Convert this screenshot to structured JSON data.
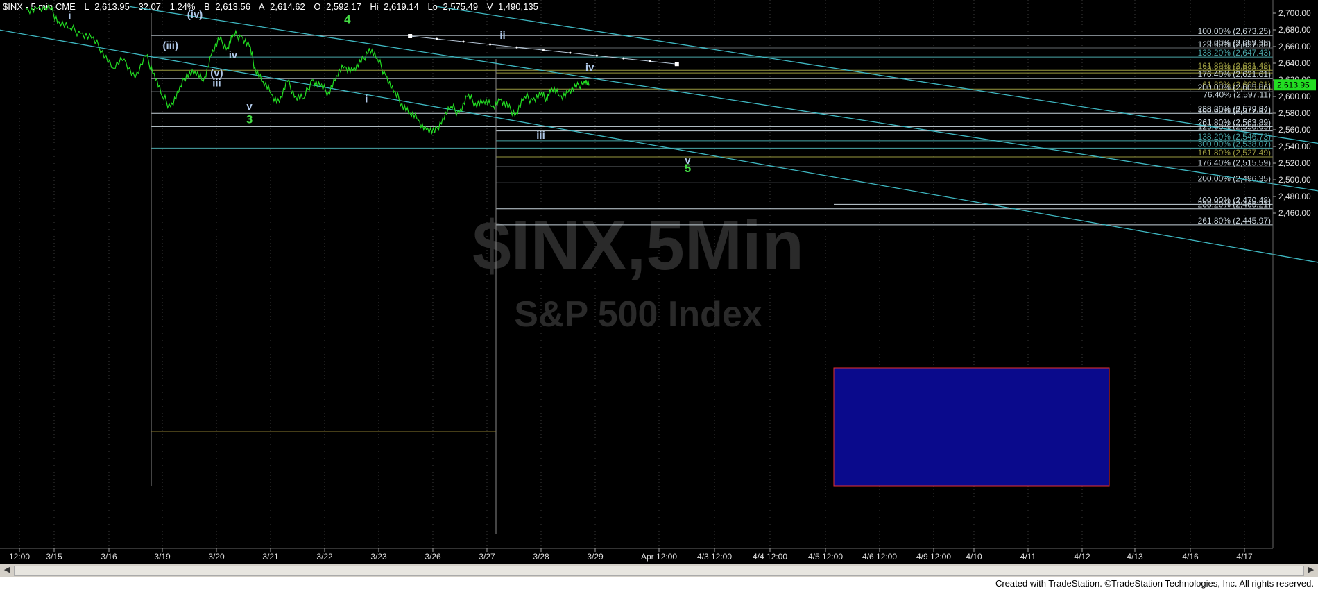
{
  "header": {
    "symbol": "$INX - 5 min  CME",
    "last": "L=2,613.95",
    "change": "32.07",
    "change_pct": "1.24%",
    "bid": "B=2,613.56",
    "ask": "A=2,614.62",
    "open": "O=2,592.17",
    "high": "Hi=2,619.14",
    "low": "Lo=2,575.49",
    "volume": "V=1,490,135"
  },
  "watermark": {
    "symbol": "$INX,5Min",
    "name": "S&P 500 Index"
  },
  "footer": {
    "credit": "Created with TradeStation. ©TradeStation Technologies, Inc. All rights reserved."
  },
  "colors": {
    "background": "#000000",
    "price": "#22dd22",
    "trendline": "#3fb8c2",
    "fib_white": "#c8d4dc",
    "fib_teal": "#4aa6a8",
    "fib_olive": "#9a9a40",
    "target_box": "#0a0a8c",
    "target_box_border": "#e83030",
    "wave_green": "#44dd44",
    "wave_blue": "#b0c8e8",
    "last_price_box": "#22dd22"
  },
  "chart_data": {
    "type": "line",
    "title": "$INX - 5 min",
    "xlabel": "",
    "ylabel": "",
    "ylim": [
      2432,
      2708
    ],
    "y_ticks": [
      "2,700.00",
      "2,680.00",
      "2,660.00",
      "2,640.00",
      "2,620.00",
      "2,600.00",
      "2,580.00",
      "2,560.00",
      "2,540.00",
      "2,520.00",
      "2,500.00",
      "2,480.00",
      "2,460.00"
    ],
    "x_ticks": [
      "12:00",
      "3/15",
      "3/16",
      "3/19",
      "3/20",
      "3/21",
      "3/22",
      "3/23",
      "3/26",
      "3/27",
      "3/28",
      "3/29",
      "Apr 12:00",
      "4/3 12:00",
      "4/4 12:00",
      "4/5 12:00",
      "4/6 12:00",
      "4/9 12:00",
      "4/10",
      "4/11",
      "4/12",
      "4/13",
      "4/16",
      "4/17"
    ],
    "last_price": "2,613.95",
    "series": [
      {
        "x": [
          0.2,
          0.4,
          0.65,
          0.8,
          1.0,
          1.2,
          1.4,
          1.6,
          1.8,
          2.0,
          2.2,
          2.4,
          2.55,
          2.7,
          2.85,
          3.0,
          3.15,
          3.3,
          3.45,
          3.6,
          3.75,
          3.9,
          4.0,
          4.15,
          4.3,
          4.4,
          4.55,
          4.7,
          4.85,
          5.0,
          5.15,
          5.3,
          5.45,
          5.6,
          5.75,
          5.9,
          6.05,
          6.2,
          6.35,
          6.5,
          6.65,
          6.8,
          6.95,
          7.1,
          7.25,
          7.4,
          7.55,
          7.7,
          7.85,
          8.0,
          8.15,
          8.3,
          8.45,
          8.6,
          8.75,
          8.9,
          9.05,
          9.2,
          9.35,
          9.5,
          9.65,
          9.75,
          9.85,
          10.0,
          10.15,
          10.3,
          10.45,
          10.55
        ],
        "values": [
          2705,
          2705,
          2704,
          2690,
          2682,
          2676,
          2670,
          2655,
          2634,
          2645,
          2622,
          2648,
          2628,
          2600,
          2588,
          2605,
          2628,
          2630,
          2618,
          2650,
          2668,
          2659,
          2674,
          2672,
          2660,
          2635,
          2618,
          2603,
          2593,
          2618,
          2600,
          2598,
          2620,
          2612,
          2605,
          2625,
          2636,
          2631,
          2640,
          2658,
          2645,
          2626,
          2605,
          2592,
          2580,
          2572,
          2560,
          2556,
          2574,
          2588,
          2580,
          2600,
          2592,
          2595,
          2588,
          2596,
          2586,
          2580,
          2600,
          2596,
          2602,
          2598,
          2610,
          2600,
          2605,
          2610,
          2619,
          2614
        ]
      }
    ],
    "fib_levels": [
      "100.00% (2,673.25)",
      "0.00% (2,659.38)",
      "123.60% (2,657.30)",
      "138.20% (2,647.43)",
      "161.80% (2,631.48)",
      "38.20% (2,628.25)",
      "176.40% (2,621.61)",
      "61.80% (2,609.01)",
      "200.00% (2,605.66)",
      "76.40% (2,597.11)",
      "238.20% (2,579.84)",
      "100.00% (2,577.87)",
      "261.80% (2,563.89)",
      "123.60% (2,558.63)",
      "138.20% (2,546.73)",
      "300.00% (2,538.07)",
      "161.80% (2,527.49)",
      "176.40% (2,515.59)",
      "200.00% (2,496.35)",
      "400.00% (2,470.48)",
      "238.20% (2,465.21)",
      "261.80% (2,445.97)"
    ],
    "fib_values": [
      2673.25,
      2659.38,
      2657.3,
      2647.43,
      2631.48,
      2628.25,
      2621.61,
      2609.01,
      2605.66,
      2597.11,
      2579.84,
      2577.87,
      2563.89,
      2558.63,
      2546.73,
      2538.07,
      2527.49,
      2515.59,
      2496.35,
      2470.48,
      2465.21,
      2445.97
    ],
    "fib_colors": [
      "white",
      "white",
      "white",
      "teal",
      "olive",
      "olive",
      "white",
      "olive",
      "white",
      "white",
      "white",
      "white",
      "white",
      "white",
      "teal",
      "teal",
      "olive",
      "white",
      "white",
      "white",
      "white",
      "white"
    ],
    "wave_labels": [
      {
        "text": "i",
        "x": 1.0,
        "y": 2693,
        "style": "blue"
      },
      {
        "text": "(iv)",
        "x": 3.3,
        "y": 2694,
        "style": "blue"
      },
      {
        "text": "(iii)",
        "x": 2.85,
        "y": 2657,
        "style": "blue"
      },
      {
        "text": "iv",
        "x": 4.0,
        "y": 2646,
        "style": "blue"
      },
      {
        "text": "(v)",
        "x": 3.7,
        "y": 2624,
        "style": "blue"
      },
      {
        "text": "iii",
        "x": 3.7,
        "y": 2612,
        "style": "blue"
      },
      {
        "text": "v",
        "x": 4.3,
        "y": 2584,
        "style": "blue"
      },
      {
        "text": "3",
        "x": 4.3,
        "y": 2568,
        "style": "green"
      },
      {
        "text": "4",
        "x": 6.1,
        "y": 2688,
        "style": "green"
      },
      {
        "text": "i",
        "x": 6.45,
        "y": 2593,
        "style": "blue"
      },
      {
        "text": "ii",
        "x": 8.95,
        "y": 2669,
        "style": "blue"
      },
      {
        "text": "iv",
        "x": 10.55,
        "y": 2631,
        "style": "blue"
      },
      {
        "text": "iii",
        "x": 9.65,
        "y": 2549,
        "style": "blue"
      },
      {
        "text": "v",
        "x": 12.35,
        "y": 2519,
        "style": "blue"
      },
      {
        "text": "5",
        "x": 12.35,
        "y": 2509,
        "style": "green"
      }
    ],
    "grid": true
  }
}
